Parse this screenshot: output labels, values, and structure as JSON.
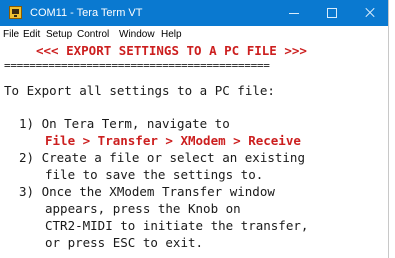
{
  "window": {
    "title": "COM11 - Tera Term VT",
    "icon": "tera-term-icon",
    "controls": [
      "minimize-icon",
      "maximize-icon",
      "close-icon"
    ]
  },
  "menu": {
    "items": [
      "File",
      "Edit",
      "Setup",
      "Control",
      "Window",
      "Help"
    ]
  },
  "terminal": {
    "heading": "<<< EXPORT SETTINGS TO A PC FILE >>>",
    "rule": "==========================================",
    "intro": "To Export all settings to a PC file:",
    "steps": {
      "s1_line1": "1) On Tera Term, navigate to",
      "s1_path": "File > Transfer > XModem > Receive",
      "s2_line1": "2) Create a file or select an existing",
      "s2_line2": "file to save the settings to.",
      "s3_line1": "3) Once the XModem Transfer window",
      "s3_line2": "appears, press the Knob on",
      "s3_line3": "CTR2-MIDI to initiate the transfer,",
      "s3_line4": "or press ESC to exit."
    },
    "colors": {
      "highlight": "#cc1f1f",
      "titlebar": "#0a79d0"
    }
  }
}
